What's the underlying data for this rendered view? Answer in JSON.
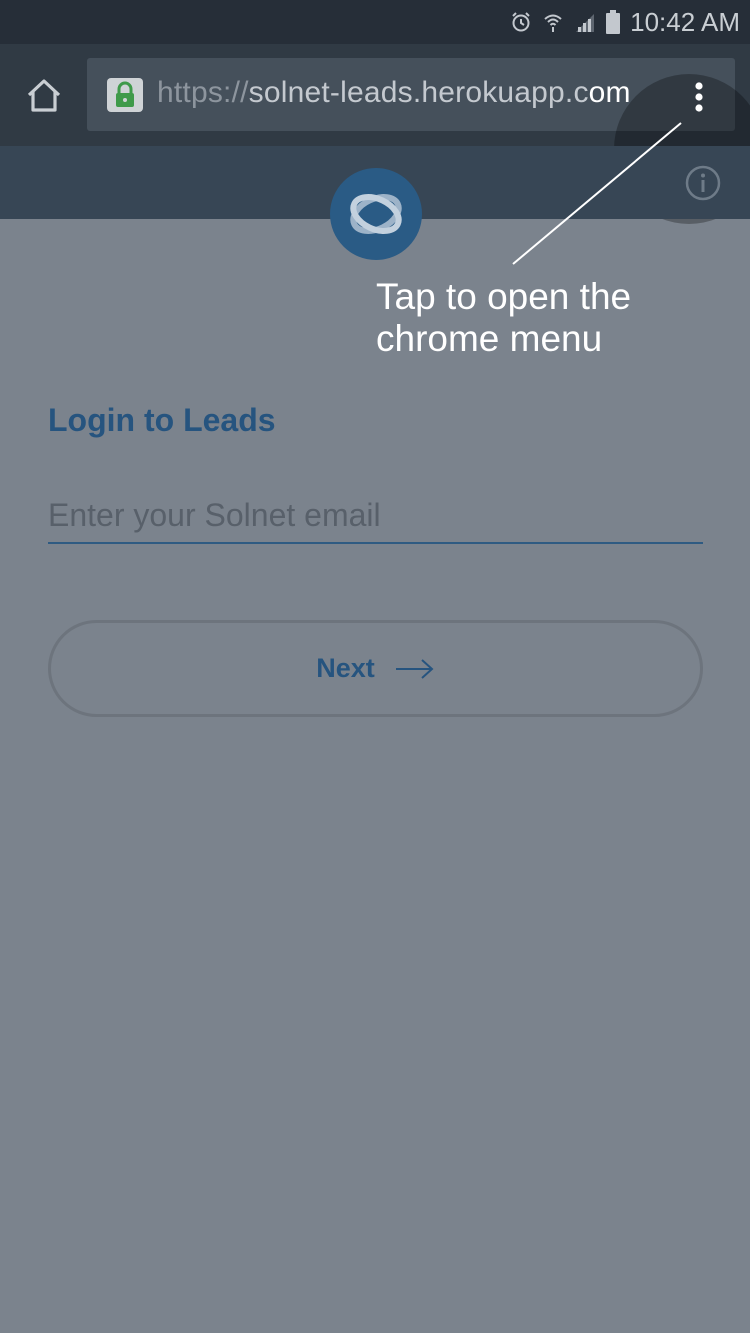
{
  "status_bar": {
    "time": "10:42 AM",
    "icons": [
      "alarm-icon",
      "wifi-icon",
      "signal-icon",
      "battery-icon"
    ]
  },
  "browser": {
    "url_scheme": "https://",
    "url_host": "solnet-leads.herokuapp.c",
    "url_tail": "om",
    "icons": [
      "home-icon",
      "lock-icon",
      "more-vert-icon"
    ]
  },
  "app": {
    "header_icons": [
      "logo-icon",
      "info-icon"
    ],
    "login_title": "Login to Leads",
    "email_placeholder": "Enter your Solnet email",
    "email_value": "",
    "next_label": "Next"
  },
  "hint": {
    "line1": "Tap to open the",
    "line2": "chrome menu"
  },
  "colors": {
    "overlay": "#7b838d",
    "brand_blue": "#26547f",
    "status_bar": "#262e38",
    "toolbar": "#303a44",
    "lock_green": "#3f9a4a"
  }
}
